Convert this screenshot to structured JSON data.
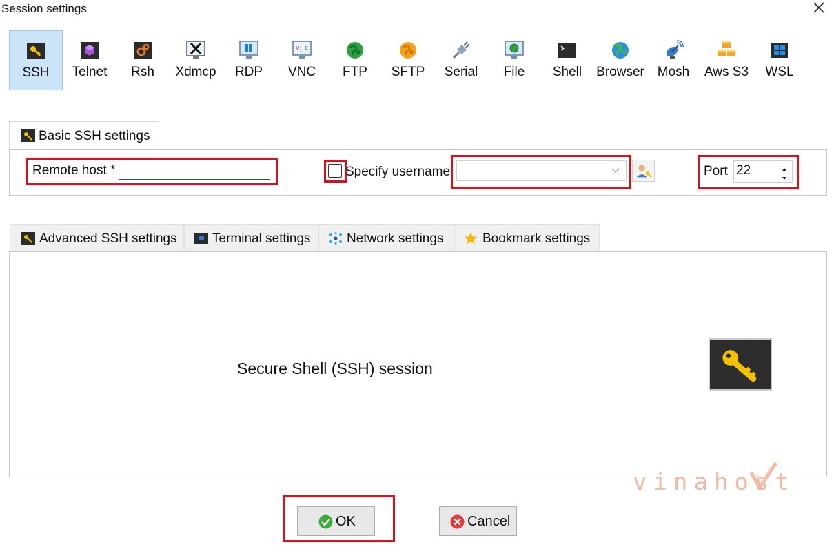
{
  "window": {
    "title": "Session settings",
    "close_icon": "close-icon"
  },
  "protocols": [
    {
      "label": "SSH",
      "icon": "ssh-key-icon",
      "selected": true
    },
    {
      "label": "Telnet",
      "icon": "telnet-icon",
      "selected": false
    },
    {
      "label": "Rsh",
      "icon": "rsh-icon",
      "selected": false
    },
    {
      "label": "Xdmcp",
      "icon": "xdmcp-icon",
      "selected": false
    },
    {
      "label": "RDP",
      "icon": "rdp-icon",
      "selected": false
    },
    {
      "label": "VNC",
      "icon": "vnc-icon",
      "selected": false
    },
    {
      "label": "FTP",
      "icon": "ftp-globe-icon",
      "selected": false
    },
    {
      "label": "SFTP",
      "icon": "sftp-globe-icon",
      "selected": false
    },
    {
      "label": "Serial",
      "icon": "serial-plug-icon",
      "selected": false
    },
    {
      "label": "File",
      "icon": "file-monitor-icon",
      "selected": false
    },
    {
      "label": "Shell",
      "icon": "shell-terminal-icon",
      "selected": false
    },
    {
      "label": "Browser",
      "icon": "browser-globe-icon",
      "selected": false
    },
    {
      "label": "Mosh",
      "icon": "mosh-satellite-icon",
      "selected": false
    },
    {
      "label": "Aws S3",
      "icon": "aws-s3-cubes-icon",
      "selected": false
    },
    {
      "label": "WSL",
      "icon": "wsl-windows-icon",
      "selected": false
    }
  ],
  "basic_tab": {
    "label": "Basic SSH settings",
    "icon": "key-icon"
  },
  "basic": {
    "remote_host_label": "Remote host *",
    "remote_host_value": "",
    "specify_username_label": "Specify username",
    "specify_username_checked": false,
    "username_value": "",
    "user_button_icon": "user-key-icon",
    "port_label": "Port",
    "port_value": "22"
  },
  "tabs": [
    {
      "label": "Advanced SSH settings",
      "icon": "key-icon"
    },
    {
      "label": "Terminal settings",
      "icon": "terminal-icon"
    },
    {
      "label": "Network settings",
      "icon": "network-icon"
    },
    {
      "label": "Bookmark settings",
      "icon": "star-icon"
    }
  ],
  "panel": {
    "description": "Secure Shell (SSH) session",
    "icon": "large-key-icon"
  },
  "watermark": {
    "text": "vinahost"
  },
  "buttons": {
    "ok_label": "OK",
    "ok_icon": "check-circle-icon",
    "cancel_label": "Cancel",
    "cancel_icon": "x-circle-icon"
  },
  "colors": {
    "highlight": "#d8121b",
    "selected_bg": "#cce4f7",
    "input_underline": "#1f4fa8"
  }
}
